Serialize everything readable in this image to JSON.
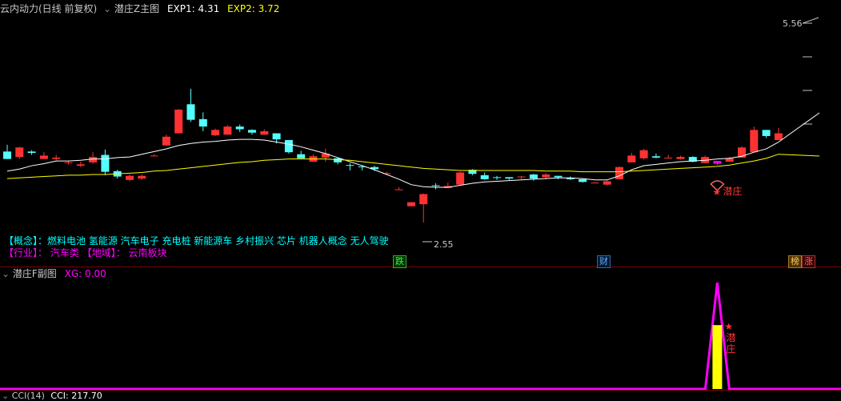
{
  "main": {
    "stock_name": "云内动力(日线 前复权)",
    "indicator": "潜庄Z主图",
    "exp1_label": "EXP1:",
    "exp1_value": "4.31",
    "exp2_label": "EXP2:",
    "exp2_value": "3.72",
    "price_high_label": "5.56",
    "price_low_label": "2.55",
    "signal_label": "潜庄",
    "concept_line": "【概念】：燃料电池 氢能源 汽车电子 充电桩 新能源车 乡村振兴 芯片 机器人概念 无人驾驶",
    "industry_prefix": "【行业】：",
    "industry_value": "汽车类",
    "region_prefix": "【地域】：",
    "region_value": "云南板块",
    "badges": [
      "跌",
      "财",
      "榜",
      "涨"
    ]
  },
  "sub": {
    "title": "潜庄F副图",
    "xg_label": "XG:",
    "xg_value": "0.00",
    "signal_label": "潜庄"
  },
  "bottom": {
    "title": "CCI(14)",
    "cci_label": "CCI:",
    "cci_value": "217.70"
  },
  "colors": {
    "up": "#ff3232",
    "down": "#54ffff",
    "ma1": "#ffffff",
    "ma2": "#ffff00",
    "signal": "#ff00ff",
    "bar": "#ffff00",
    "divider": "#800000"
  },
  "chart_data": {
    "type": "candlestick",
    "price_range": [
      2.55,
      5.56
    ],
    "candles": [
      {
        "o": 3.66,
        "h": 3.76,
        "l": 3.55,
        "c": 3.55
      },
      {
        "o": 3.58,
        "h": 3.73,
        "l": 3.55,
        "c": 3.72
      },
      {
        "o": 3.66,
        "h": 3.68,
        "l": 3.61,
        "c": 3.64
      },
      {
        "o": 3.55,
        "h": 3.65,
        "l": 3.55,
        "c": 3.6
      },
      {
        "o": 3.55,
        "h": 3.61,
        "l": 3.53,
        "c": 3.57
      },
      {
        "o": 3.5,
        "h": 3.52,
        "l": 3.47,
        "c": 3.5
      },
      {
        "o": 3.45,
        "h": 3.51,
        "l": 3.43,
        "c": 3.47
      },
      {
        "o": 3.5,
        "h": 3.65,
        "l": 3.48,
        "c": 3.58
      },
      {
        "o": 3.61,
        "h": 3.69,
        "l": 3.31,
        "c": 3.36
      },
      {
        "o": 3.37,
        "h": 3.39,
        "l": 3.26,
        "c": 3.29
      },
      {
        "o": 3.24,
        "h": 3.32,
        "l": 3.22,
        "c": 3.3
      },
      {
        "o": 3.26,
        "h": 3.32,
        "l": 3.24,
        "c": 3.3
      },
      {
        "o": 3.6,
        "h": 3.62,
        "l": 3.6,
        "c": 3.6
      },
      {
        "o": 3.75,
        "h": 3.91,
        "l": 3.75,
        "c": 3.88
      },
      {
        "o": 3.93,
        "h": 4.29,
        "l": 3.93,
        "c": 4.28
      },
      {
        "o": 4.36,
        "h": 4.59,
        "l": 4.1,
        "c": 4.13
      },
      {
        "o": 4.14,
        "h": 4.24,
        "l": 3.96,
        "c": 4.03
      },
      {
        "o": 3.9,
        "h": 4.0,
        "l": 3.89,
        "c": 3.98
      },
      {
        "o": 3.91,
        "h": 4.05,
        "l": 3.91,
        "c": 4.03
      },
      {
        "o": 4.03,
        "h": 4.06,
        "l": 3.95,
        "c": 3.99
      },
      {
        "o": 3.98,
        "h": 3.99,
        "l": 3.91,
        "c": 3.94
      },
      {
        "o": 3.91,
        "h": 3.99,
        "l": 3.91,
        "c": 3.96
      },
      {
        "o": 3.93,
        "h": 3.93,
        "l": 3.78,
        "c": 3.84
      },
      {
        "o": 3.83,
        "h": 3.83,
        "l": 3.63,
        "c": 3.65
      },
      {
        "o": 3.62,
        "h": 3.67,
        "l": 3.56,
        "c": 3.56
      },
      {
        "o": 3.51,
        "h": 3.62,
        "l": 3.51,
        "c": 3.59
      },
      {
        "o": 3.57,
        "h": 3.7,
        "l": 3.51,
        "c": 3.63
      },
      {
        "o": 3.56,
        "h": 3.57,
        "l": 3.47,
        "c": 3.5
      },
      {
        "o": 3.46,
        "h": 3.49,
        "l": 3.38,
        "c": 3.45
      },
      {
        "o": 3.44,
        "h": 3.46,
        "l": 3.38,
        "c": 3.43
      },
      {
        "o": 3.43,
        "h": 3.45,
        "l": 3.37,
        "c": 3.4
      },
      {
        "o": 3.34,
        "h": 3.36,
        "l": 3.31,
        "c": 3.34
      },
      {
        "o": 3.1,
        "h": 3.13,
        "l": 3.1,
        "c": 3.1
      },
      {
        "o": 2.85,
        "h": 2.91,
        "l": 2.85,
        "c": 2.91
      },
      {
        "o": 2.88,
        "h": 3.04,
        "l": 2.61,
        "c": 3.03
      },
      {
        "o": 3.16,
        "h": 3.19,
        "l": 3.1,
        "c": 3.15
      },
      {
        "o": 3.12,
        "h": 3.2,
        "l": 3.12,
        "c": 3.15
      },
      {
        "o": 3.17,
        "h": 3.36,
        "l": 3.17,
        "c": 3.35
      },
      {
        "o": 3.39,
        "h": 3.4,
        "l": 3.31,
        "c": 3.33
      },
      {
        "o": 3.31,
        "h": 3.35,
        "l": 3.24,
        "c": 3.25
      },
      {
        "o": 3.28,
        "h": 3.3,
        "l": 3.24,
        "c": 3.27
      },
      {
        "o": 3.28,
        "h": 3.28,
        "l": 3.24,
        "c": 3.26
      },
      {
        "o": 3.28,
        "h": 3.3,
        "l": 3.25,
        "c": 3.29
      },
      {
        "o": 3.32,
        "h": 3.33,
        "l": 3.23,
        "c": 3.26
      },
      {
        "o": 3.28,
        "h": 3.34,
        "l": 3.25,
        "c": 3.32
      },
      {
        "o": 3.3,
        "h": 3.3,
        "l": 3.25,
        "c": 3.28
      },
      {
        "o": 3.27,
        "h": 3.29,
        "l": 3.24,
        "c": 3.25
      },
      {
        "o": 3.25,
        "h": 3.26,
        "l": 3.2,
        "c": 3.21
      },
      {
        "o": 3.2,
        "h": 3.21,
        "l": 3.2,
        "c": 3.2
      },
      {
        "o": 3.17,
        "h": 3.23,
        "l": 3.16,
        "c": 3.22
      },
      {
        "o": 3.25,
        "h": 3.44,
        "l": 3.25,
        "c": 3.43
      },
      {
        "o": 3.5,
        "h": 3.64,
        "l": 3.5,
        "c": 3.6
      },
      {
        "o": 3.56,
        "h": 3.7,
        "l": 3.54,
        "c": 3.68
      },
      {
        "o": 3.59,
        "h": 3.63,
        "l": 3.56,
        "c": 3.57
      },
      {
        "o": 3.57,
        "h": 3.61,
        "l": 3.56,
        "c": 3.57
      },
      {
        "o": 3.55,
        "h": 3.6,
        "l": 3.54,
        "c": 3.58
      },
      {
        "o": 3.58,
        "h": 3.59,
        "l": 3.5,
        "c": 3.51
      },
      {
        "o": 3.49,
        "h": 3.6,
        "l": 3.49,
        "c": 3.58
      },
      {
        "o": 3.48,
        "h": 3.52,
        "l": 3.46,
        "c": 3.52
      },
      {
        "o": 3.51,
        "h": 3.58,
        "l": 3.51,
        "c": 3.56
      },
      {
        "o": 3.57,
        "h": 3.74,
        "l": 3.57,
        "c": 3.72
      },
      {
        "o": 3.65,
        "h": 4.03,
        "l": 3.65,
        "c": 3.98
      },
      {
        "o": 3.98,
        "h": 3.98,
        "l": 3.86,
        "c": 3.89
      },
      {
        "o": 3.83,
        "h": 4.01,
        "l": 3.83,
        "c": 3.93
      }
    ],
    "ma1": [
      3.37,
      3.4,
      3.45,
      3.48,
      3.52,
      3.52,
      3.53,
      3.55,
      3.55,
      3.57,
      3.58,
      3.62,
      3.66,
      3.7,
      3.75,
      3.78,
      3.8,
      3.81,
      3.83,
      3.84,
      3.84,
      3.83,
      3.8,
      3.77,
      3.73,
      3.68,
      3.63,
      3.57,
      3.51,
      3.45,
      3.39,
      3.32,
      3.25,
      3.17,
      3.14,
      3.13,
      3.13,
      3.16,
      3.19,
      3.21,
      3.22,
      3.23,
      3.24,
      3.25,
      3.26,
      3.27,
      3.27,
      3.26,
      3.24,
      3.24,
      3.3,
      3.39,
      3.45,
      3.47,
      3.49,
      3.51,
      3.52,
      3.53,
      3.55,
      3.56,
      3.59,
      3.65,
      3.7,
      3.8
    ],
    "ma2": [
      3.26,
      3.27,
      3.28,
      3.29,
      3.3,
      3.31,
      3.31,
      3.32,
      3.32,
      3.33,
      3.34,
      3.35,
      3.37,
      3.38,
      3.4,
      3.42,
      3.44,
      3.46,
      3.48,
      3.5,
      3.51,
      3.53,
      3.54,
      3.55,
      3.55,
      3.55,
      3.55,
      3.54,
      3.53,
      3.51,
      3.49,
      3.47,
      3.45,
      3.43,
      3.41,
      3.4,
      3.39,
      3.38,
      3.38,
      3.38,
      3.38,
      3.38,
      3.38,
      3.38,
      3.37,
      3.37,
      3.37,
      3.36,
      3.36,
      3.36,
      3.36,
      3.37,
      3.38,
      3.39,
      3.4,
      3.41,
      3.42,
      3.43,
      3.44,
      3.46,
      3.49,
      3.52,
      3.56,
      3.62
    ],
    "signal_index": 58,
    "sub_spike": {
      "index": 58,
      "peak": 1.0,
      "bar_value": 0.6
    }
  }
}
